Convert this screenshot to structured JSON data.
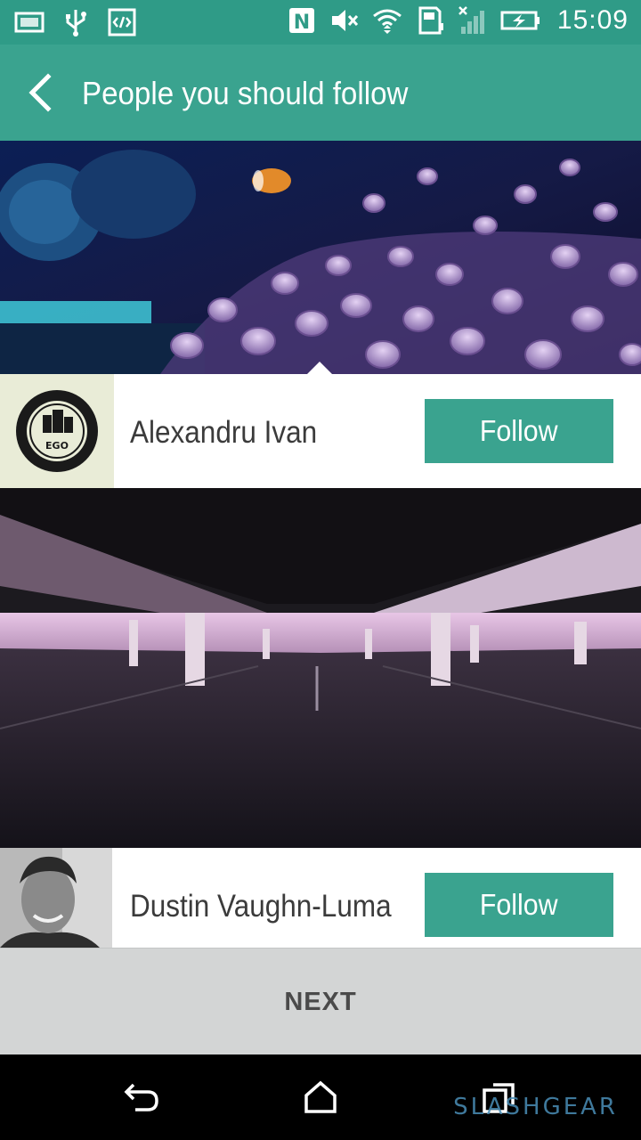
{
  "status_bar": {
    "time": "15:09",
    "left_icons": [
      "picture-icon",
      "usb-icon",
      "code-icon"
    ],
    "right_icons": [
      "nfc-icon",
      "mute-icon",
      "wifi-icon",
      "sd-card-icon",
      "signal-icon",
      "battery-charging-icon"
    ]
  },
  "app_bar": {
    "title": "People you should follow",
    "back_icon": "chevron-left-icon"
  },
  "people": [
    {
      "name": "Alexandru Ivan",
      "follow_label": "Follow"
    },
    {
      "name": "Dustin Vaughn-Luma",
      "follow_label": "Follow"
    }
  ],
  "next_label": "NEXT",
  "nav_bar": {
    "icons": [
      "back-icon",
      "home-icon",
      "recent-apps-icon"
    ]
  },
  "watermark": "SLASHGEAR",
  "colors": {
    "primary": "#3aa38f",
    "status_bar": "#2f9b87",
    "next_bar": "#d3d5d5"
  }
}
